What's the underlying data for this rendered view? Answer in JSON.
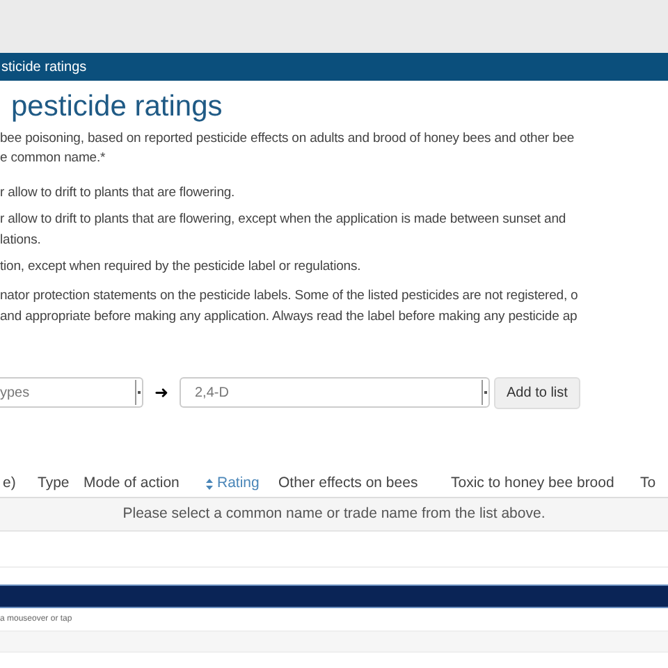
{
  "header_bar": {
    "title": "sticide ratings"
  },
  "page_title": "pesticide ratings",
  "intro": {
    "lines": [
      "bee poisoning, based on reported pesticide effects on adults and brood of honey bees and other bee",
      "e common name.*"
    ]
  },
  "ratings": [
    {
      "lines": [
        "r allow to drift to plants that are flowering."
      ]
    },
    {
      "lines": [
        "r allow to drift to plants that are flowering, except when the application is made between sunset and",
        "lations."
      ]
    },
    {
      "lines": [
        "tion, except when required by the pesticide label or regulations."
      ]
    }
  ],
  "note": {
    "lines": [
      "nator protection statements on the pesticide labels. Some of the listed pesticides are not registered, o",
      "and appropriate before making any application. Always read the label before making any pesticide ap"
    ]
  },
  "filters": {
    "type_select": {
      "value": "ypes"
    },
    "arrow": "➜",
    "name_select": {
      "value": "2,4-D"
    },
    "add_button": "Add to list"
  },
  "table": {
    "columns": [
      {
        "label": "e)",
        "sortable": false
      },
      {
        "label": "Type",
        "sortable": false
      },
      {
        "label": "Mode of action",
        "sortable": false
      },
      {
        "label": "Rating",
        "sortable": true
      },
      {
        "label": "Other effects on bees",
        "sortable": false
      },
      {
        "label": "Toxic to honey bee brood",
        "sortable": false
      },
      {
        "label": "To",
        "sortable": false
      }
    ],
    "empty_message": "Please select a common name or trade name from the list above."
  },
  "legend_note": "a mouseover or tap"
}
